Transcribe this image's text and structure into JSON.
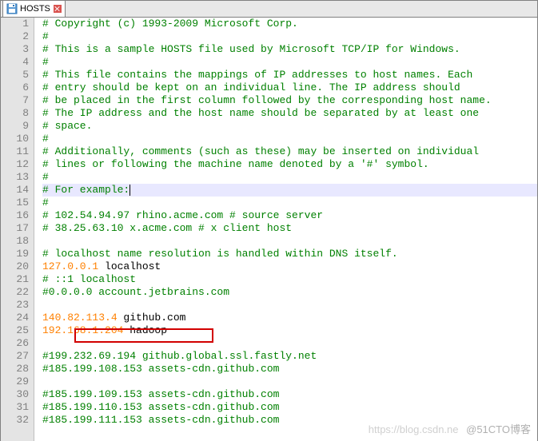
{
  "tab": {
    "label": "HOSTS"
  },
  "lines": [
    {
      "n": 1,
      "segs": [
        {
          "cls": "c",
          "t": "# Copyright (c) 1993-2009 Microsoft Corp."
        }
      ]
    },
    {
      "n": 2,
      "segs": [
        {
          "cls": "c",
          "t": "#"
        }
      ]
    },
    {
      "n": 3,
      "segs": [
        {
          "cls": "c",
          "t": "# This is a sample HOSTS file used by Microsoft TCP/IP for Windows."
        }
      ]
    },
    {
      "n": 4,
      "segs": [
        {
          "cls": "c",
          "t": "#"
        }
      ]
    },
    {
      "n": 5,
      "segs": [
        {
          "cls": "c",
          "t": "# This file contains the mappings of IP addresses to host names. Each"
        }
      ]
    },
    {
      "n": 6,
      "segs": [
        {
          "cls": "c",
          "t": "# entry should be kept on an individual line. The IP address should"
        }
      ]
    },
    {
      "n": 7,
      "segs": [
        {
          "cls": "c",
          "t": "# be placed in the first column followed by the corresponding host name."
        }
      ]
    },
    {
      "n": 8,
      "segs": [
        {
          "cls": "c",
          "t": "# The IP address and the host name should be separated by at least one"
        }
      ]
    },
    {
      "n": 9,
      "segs": [
        {
          "cls": "c",
          "t": "# space."
        }
      ]
    },
    {
      "n": 10,
      "segs": [
        {
          "cls": "c",
          "t": "#"
        }
      ]
    },
    {
      "n": 11,
      "segs": [
        {
          "cls": "c",
          "t": "# Additionally, comments (such as these) may be inserted on individual"
        }
      ]
    },
    {
      "n": 12,
      "segs": [
        {
          "cls": "c",
          "t": "# lines or following the machine name denoted by a '#' symbol."
        }
      ]
    },
    {
      "n": 13,
      "segs": [
        {
          "cls": "c",
          "t": "#"
        }
      ]
    },
    {
      "n": 14,
      "cursor": true,
      "segs": [
        {
          "cls": "c",
          "t": "# For example:"
        }
      ]
    },
    {
      "n": 15,
      "segs": [
        {
          "cls": "c",
          "t": "#"
        }
      ]
    },
    {
      "n": 16,
      "segs": [
        {
          "cls": "c",
          "t": "# 102.54.94.97 rhino.acme.com # source server"
        }
      ]
    },
    {
      "n": 17,
      "segs": [
        {
          "cls": "c",
          "t": "# 38.25.63.10 x.acme.com # x client host"
        }
      ]
    },
    {
      "n": 18,
      "segs": []
    },
    {
      "n": 19,
      "segs": [
        {
          "cls": "c",
          "t": "# localhost name resolution is handled within DNS itself."
        }
      ]
    },
    {
      "n": 20,
      "segs": [
        {
          "cls": "ip",
          "t": "127.0.0.1"
        },
        {
          "cls": "hn",
          "t": " localhost"
        }
      ]
    },
    {
      "n": 21,
      "segs": [
        {
          "cls": "c",
          "t": "# ::1 localhost"
        }
      ]
    },
    {
      "n": 22,
      "segs": [
        {
          "cls": "c",
          "t": "#0.0.0.0 account.jetbrains.com"
        }
      ]
    },
    {
      "n": 23,
      "segs": []
    },
    {
      "n": 24,
      "segs": [
        {
          "cls": "ip",
          "t": "140.82.113.4"
        },
        {
          "cls": "hn",
          "t": " github.com"
        }
      ]
    },
    {
      "n": 25,
      "segs": [
        {
          "cls": "ip",
          "t": "192.168.1.204"
        },
        {
          "cls": "hn",
          "t": " hadoop"
        }
      ]
    },
    {
      "n": 26,
      "segs": []
    },
    {
      "n": 27,
      "segs": [
        {
          "cls": "c",
          "t": "#199.232.69.194 github.global.ssl.fastly.net"
        }
      ]
    },
    {
      "n": 28,
      "segs": [
        {
          "cls": "c",
          "t": "#185.199.108.153 assets-cdn.github.com"
        }
      ]
    },
    {
      "n": 29,
      "segs": []
    },
    {
      "n": 30,
      "segs": [
        {
          "cls": "c",
          "t": "#185.199.109.153 assets-cdn.github.com"
        }
      ]
    },
    {
      "n": 31,
      "segs": [
        {
          "cls": "c",
          "t": "#185.199.110.153 assets-cdn.github.com"
        }
      ]
    },
    {
      "n": 32,
      "segs": [
        {
          "cls": "c",
          "t": "#185.199.111.153 assets-cdn.github.com"
        }
      ]
    }
  ],
  "watermark_left": "https://blog.csdn.ne",
  "watermark_right": "@51CTO博客",
  "colors": {
    "comment": "#008000",
    "ip": "#ff8000",
    "gutter": "#808080",
    "cursor_line": "#e8e8ff",
    "highlight_box": "#d20000"
  }
}
